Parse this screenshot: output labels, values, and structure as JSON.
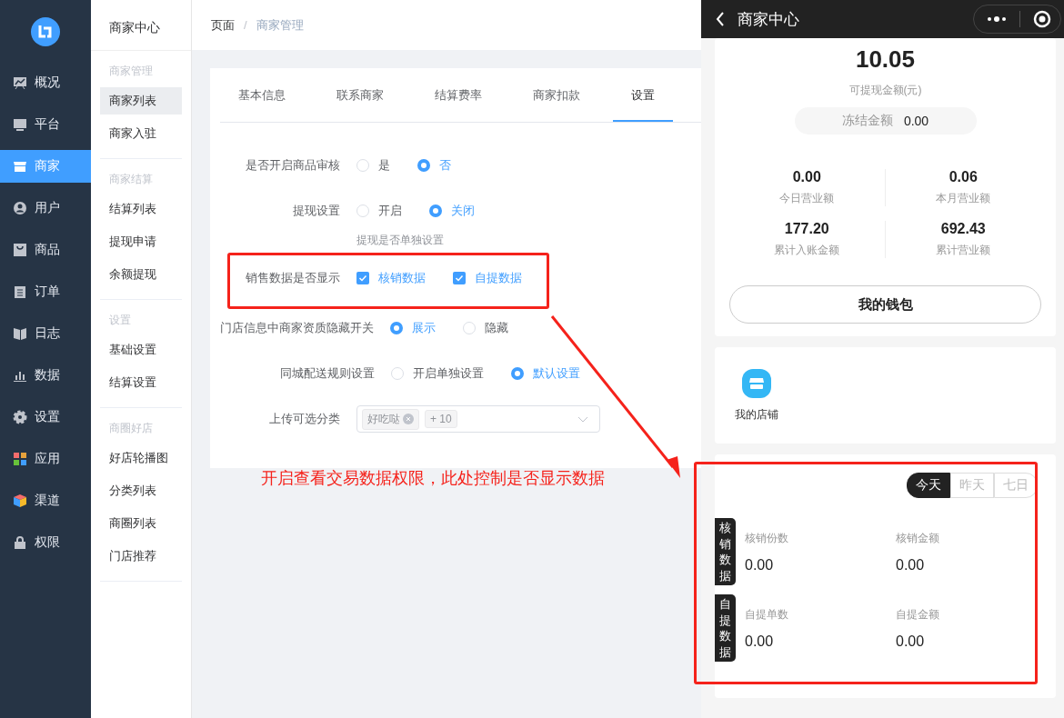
{
  "nav": {
    "items": [
      {
        "label": "概况",
        "selected": false
      },
      {
        "label": "平台",
        "selected": false
      },
      {
        "label": "商家",
        "selected": true
      },
      {
        "label": "用户",
        "selected": false
      },
      {
        "label": "商品",
        "selected": false
      },
      {
        "label": "订单",
        "selected": false
      },
      {
        "label": "日志",
        "selected": false
      },
      {
        "label": "数据",
        "selected": false
      },
      {
        "label": "设置",
        "selected": false
      },
      {
        "label": "应用",
        "selected": false
      },
      {
        "label": "渠道",
        "selected": false
      },
      {
        "label": "权限",
        "selected": false
      }
    ]
  },
  "subnav": {
    "title": "商家中心",
    "groups": [
      {
        "heading": "商家管理",
        "items": [
          {
            "label": "商家列表",
            "selected": true
          },
          {
            "label": "商家入驻",
            "selected": false
          }
        ]
      },
      {
        "heading": "商家结算",
        "items": [
          {
            "label": "结算列表",
            "selected": false
          },
          {
            "label": "提现申请",
            "selected": false
          },
          {
            "label": "余额提现",
            "selected": false
          }
        ]
      },
      {
        "heading": "设置",
        "items": [
          {
            "label": "基础设置",
            "selected": false
          },
          {
            "label": "结算设置",
            "selected": false
          }
        ]
      },
      {
        "heading": "商圈好店",
        "items": [
          {
            "label": "好店轮播图",
            "selected": false
          },
          {
            "label": "分类列表",
            "selected": false
          },
          {
            "label": "商圈列表",
            "selected": false
          },
          {
            "label": "门店推荐",
            "selected": false
          }
        ]
      }
    ]
  },
  "breadcrumb": {
    "items": [
      "页面",
      "商家管理"
    ],
    "separator": "/"
  },
  "tabs": [
    {
      "label": "基本信息",
      "selected": false
    },
    {
      "label": "联系商家",
      "selected": false
    },
    {
      "label": "结算费率",
      "selected": false
    },
    {
      "label": "商家扣款",
      "selected": false
    },
    {
      "label": "设置",
      "selected": true
    }
  ],
  "form": [
    {
      "kind": "radio",
      "label": "是否开启商品审核",
      "options": [
        {
          "label": "是",
          "selected": false
        },
        {
          "label": "否",
          "selected": true
        }
      ]
    },
    {
      "kind": "radio",
      "label": "提现设置",
      "options": [
        {
          "label": "开启",
          "selected": false
        },
        {
          "label": "关闭",
          "selected": true
        }
      ],
      "hint": "提现是否单独设置"
    },
    {
      "kind": "checkbox",
      "label": "销售数据是否显示",
      "options": [
        {
          "label": "核销数据",
          "checked": true
        },
        {
          "label": "自提数据",
          "checked": true
        }
      ]
    },
    {
      "kind": "radio",
      "label": "门店信息中商家资质隐藏开关",
      "options": [
        {
          "label": "展示",
          "selected": true
        },
        {
          "label": "隐藏",
          "selected": false
        }
      ]
    },
    {
      "kind": "radio",
      "label": "同城配送规则设置",
      "options": [
        {
          "label": "开启单独设置",
          "selected": false
        },
        {
          "label": "默认设置",
          "selected": true
        }
      ]
    },
    {
      "kind": "select",
      "label": "上传可选分类",
      "tags": [
        "好吃哒"
      ],
      "more": "+ 10"
    }
  ],
  "annotation": {
    "text": "开启查看交易数据权限，此处控制是否显示数据"
  },
  "phone": {
    "title": "商家中心",
    "balance": "10.05",
    "balance_label": "可提现金额(元)",
    "frozen_label": "冻结金额",
    "frozen_value": "0.00",
    "stats": [
      {
        "value": "0.00",
        "label": "今日营业额"
      },
      {
        "value": "0.06",
        "label": "本月营业额"
      },
      {
        "value": "177.20",
        "label": "累计入账金额"
      },
      {
        "value": "692.43",
        "label": "累计营业额"
      }
    ],
    "wallet_button": "我的钱包",
    "shortcuts": [
      {
        "label": "我的店铺"
      }
    ],
    "periods": [
      {
        "label": "今天",
        "selected": true
      },
      {
        "label": "昨天",
        "selected": false
      },
      {
        "label": "七日",
        "selected": false
      }
    ],
    "data_groups": [
      {
        "title": "核销数据",
        "metrics": [
          {
            "label": "核销份数",
            "value": "0.00"
          },
          {
            "label": "核销金额",
            "value": "0.00"
          }
        ]
      },
      {
        "title": "自提数据",
        "metrics": [
          {
            "label": "自提单数",
            "value": "0.00"
          },
          {
            "label": "自提金额",
            "value": "0.00"
          }
        ]
      }
    ]
  }
}
